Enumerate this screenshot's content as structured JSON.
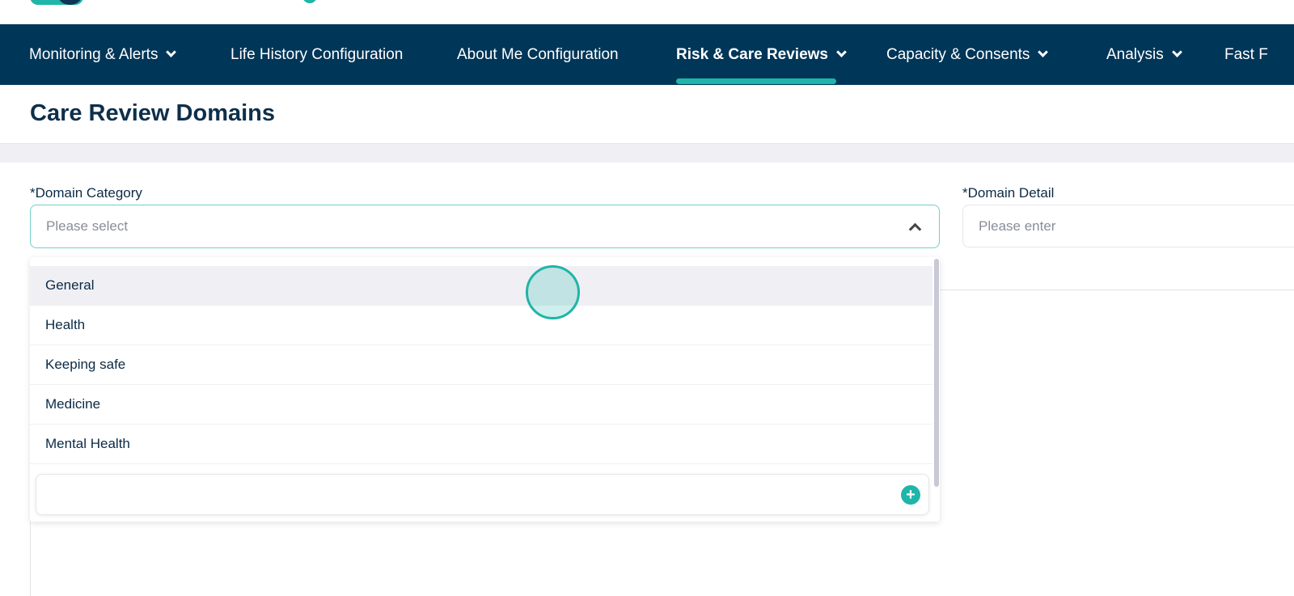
{
  "nav": {
    "items": [
      {
        "label": "Monitoring & Alerts",
        "dropdown": true
      },
      {
        "label": "Life History Configuration",
        "dropdown": false
      },
      {
        "label": "About Me Configuration",
        "dropdown": false
      },
      {
        "label": "Risk & Care Reviews",
        "dropdown": true,
        "active": true
      },
      {
        "label": "Capacity & Consents",
        "dropdown": true
      },
      {
        "label": "Analysis",
        "dropdown": true
      },
      {
        "label": "Fast F",
        "dropdown": false
      }
    ]
  },
  "page": {
    "title": "Care Review Domains"
  },
  "form": {
    "category_label": "*Domain Category",
    "category_placeholder": "Please select",
    "detail_label": "*Domain Detail",
    "detail_placeholder": "Please enter",
    "options": [
      "General",
      "Health",
      "Keeping safe",
      "Medicine",
      "Mental Health"
    ],
    "add_icon": "plus-circle-icon"
  },
  "colors": {
    "nav_bg": "#003658",
    "accent": "#1fb5a8"
  }
}
